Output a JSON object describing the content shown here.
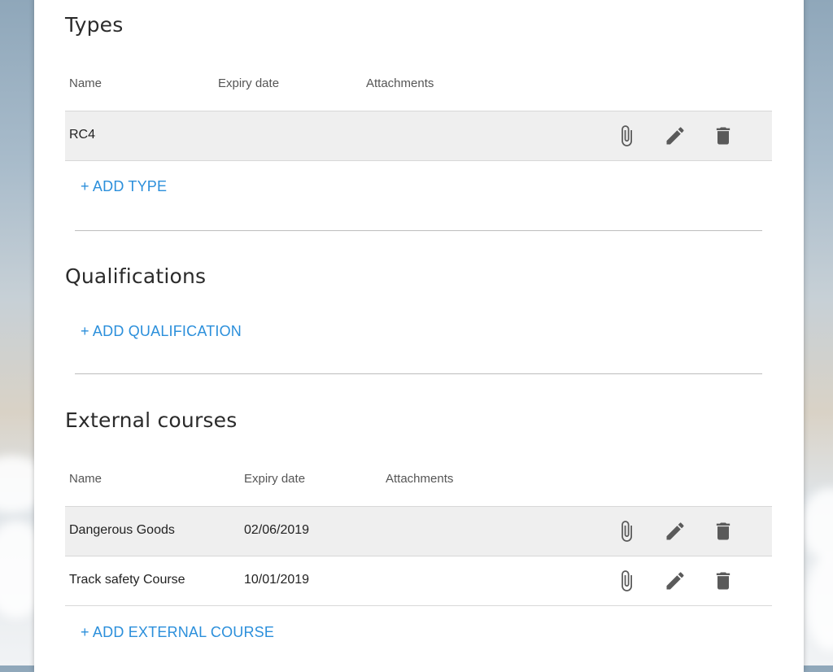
{
  "types": {
    "title": "Types",
    "columns": {
      "name": "Name",
      "expiry": "Expiry date",
      "attachments": "Attachments"
    },
    "rows": [
      {
        "name": "RC4",
        "expiry": ""
      }
    ],
    "add_label": "+ ADD TYPE"
  },
  "qualifications": {
    "title": "Qualifications",
    "add_label": "+ ADD QUALIFICATION"
  },
  "external_courses": {
    "title": "External courses",
    "columns": {
      "name": "Name",
      "expiry": "Expiry date",
      "attachments": "Attachments"
    },
    "rows": [
      {
        "name": "Dangerous Goods",
        "expiry": "02/06/2019"
      },
      {
        "name": "Track safety Course",
        "expiry": "10/01/2019"
      }
    ],
    "add_label": "+ ADD EXTERNAL COURSE"
  },
  "icons": {
    "attach": "paperclip-icon",
    "edit": "pencil-icon",
    "delete": "trash-icon"
  },
  "colors": {
    "link": "#2b8fdb",
    "row_shade": "#efefef",
    "icon": "#5a5a5a"
  }
}
